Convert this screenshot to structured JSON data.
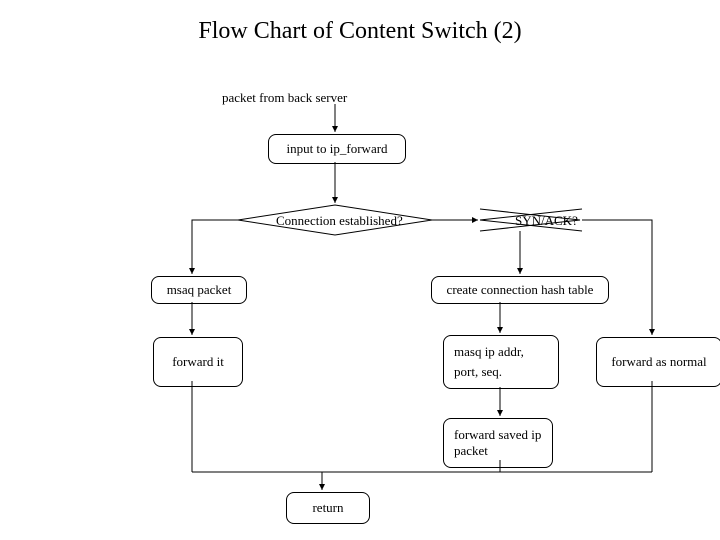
{
  "title": "Flow Chart of Content Switch (2)",
  "start": "packet from back server",
  "input": "input to ip_forward",
  "decision1": "Connection established?",
  "decision2": "SYN/ACK?",
  "msaq": "msaq packet",
  "createHash": "create connection hash table",
  "forwardIt": "forward it",
  "masqLine1": "masq ip addr,",
  "masqLine2": "port, seq.",
  "forwardNormal": "forward as normal",
  "forwardSaved": "forward saved ip packet",
  "return": "return"
}
